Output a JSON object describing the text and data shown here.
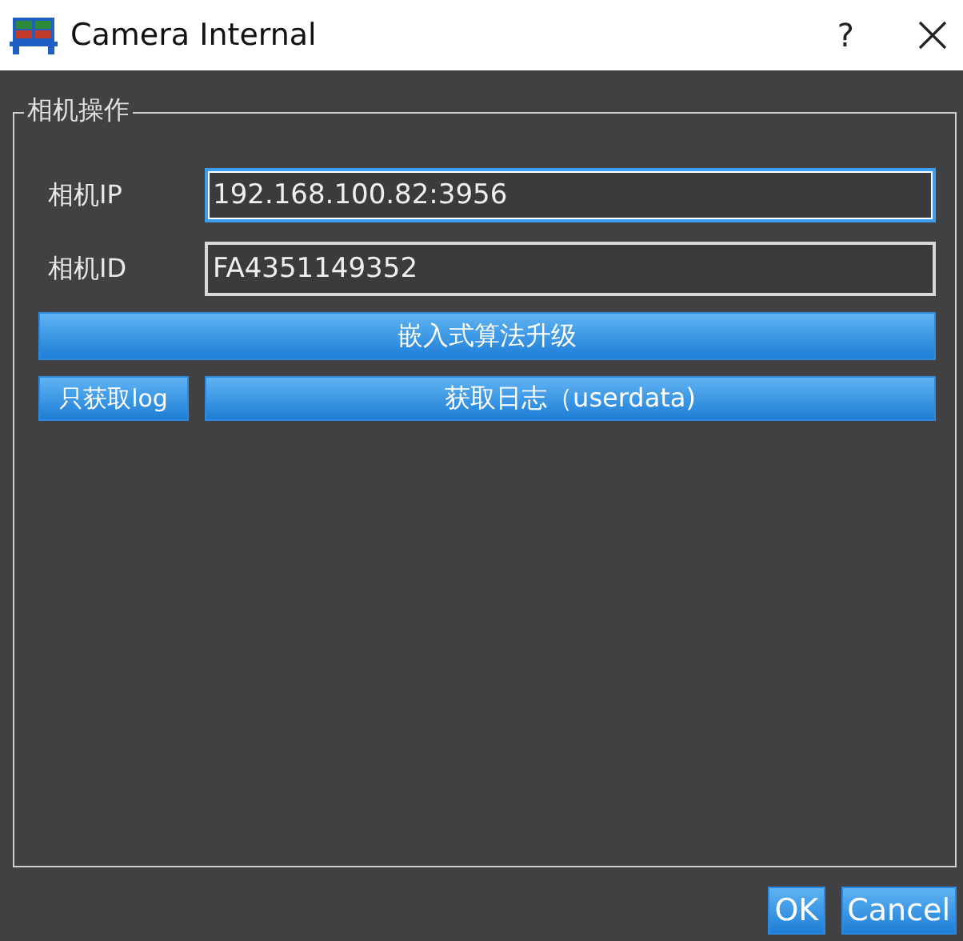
{
  "window": {
    "title": "Camera Internal",
    "help": "?"
  },
  "group": {
    "title": "相机操作",
    "fields": [
      {
        "label": "相机IP",
        "value": "192.168.100.82:3956",
        "focused": true
      },
      {
        "label": "相机ID",
        "value": "FA4351149352",
        "focused": false
      }
    ],
    "upgrade_button": "嵌入式算法升级",
    "log_buttons": [
      "只获取log",
      "获取日志（userdata)"
    ]
  },
  "buttons": [
    "OK",
    "Cancel"
  ]
}
